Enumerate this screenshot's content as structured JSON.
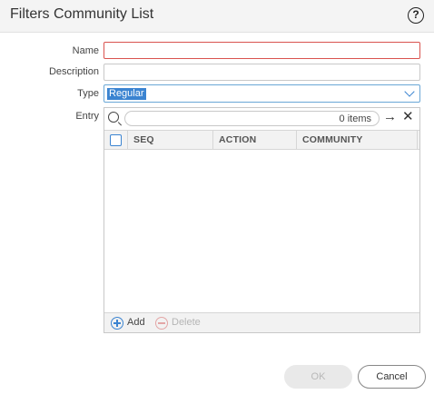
{
  "dialog": {
    "title": "Filters Community List",
    "help_icon": "question-circle-icon",
    "help_glyph": "?"
  },
  "form": {
    "name_label": "Name",
    "name_value": "",
    "description_label": "Description",
    "description_value": "",
    "type_label": "Type",
    "type_value": "Regular",
    "entry_label": "Entry"
  },
  "entry": {
    "item_count": "0 items",
    "go_glyph": "→",
    "clear_glyph": "✕",
    "columns": [
      "SEQ",
      "ACTION",
      "COMMUNITY"
    ],
    "rows": [],
    "add_label": "Add",
    "delete_label": "Delete"
  },
  "buttons": {
    "ok_label": "OK",
    "cancel_label": "Cancel"
  },
  "colors": {
    "accent": "#3b84d1",
    "error_border": "#d9534f",
    "header_bg": "#f4f4f4"
  }
}
